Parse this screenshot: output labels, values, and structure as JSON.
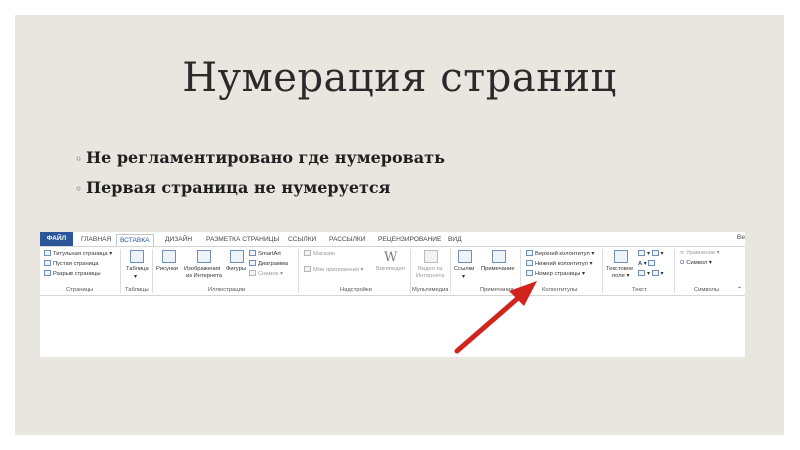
{
  "slide": {
    "title": "Нумерация страниц",
    "bullets": [
      {
        "marker": "◦",
        "text": "Не регламентировано где нумеровать"
      },
      {
        "marker": "◦",
        "text": "Первая страница не нумеруется"
      }
    ]
  },
  "word": {
    "tabs": [
      "ФАЙЛ",
      "ГЛАВНАЯ",
      "ВСТАВКА",
      "ДИЗАЙН",
      "РАЗМЕТКА СТРАНИЦЫ",
      "ССЫЛКИ",
      "РАССЫЛКИ",
      "РЕЦЕНЗИРОВАНИЕ",
      "ВИД"
    ],
    "tab_right": "Ве",
    "active_tab": "ВСТАВКА",
    "pages": {
      "title_page": "Титульная страница",
      "blank_page": "Пустая страница",
      "page_break": "Разрыв страницы",
      "group": "Страницы"
    },
    "tables": {
      "table": "Таблица",
      "group": "Таблицы"
    },
    "illustrations": {
      "pictures": "Рисунки",
      "online_pictures_1": "Изображения",
      "online_pictures_2": "из Интернета",
      "shapes": "Фигуры",
      "smartart": "SmartArt",
      "chart": "Диаграмма",
      "screenshot": "Снимок",
      "group": "Иллюстрации"
    },
    "addins": {
      "store": "Магазин",
      "my_apps": "Мои приложения",
      "wikipedia": "Википедия",
      "group": "Надстройки"
    },
    "media": {
      "video_1": "Видео из",
      "video_2": "Интернета",
      "group": "Мультимедиа"
    },
    "links": {
      "links": "Ссылки"
    },
    "comments": {
      "comment": "Примечание",
      "group": "Примечания"
    },
    "header_footer": {
      "header": "Верхний колонтитул",
      "footer": "Нижний колонтитул",
      "page_number": "Номер страницы",
      "group": "Колонтитулы"
    },
    "text": {
      "textbox_1": "Текстовое",
      "textbox_2": "поле",
      "group": "Текст"
    },
    "symbols": {
      "equation": "Уравнение",
      "symbol": "Символ",
      "group": "Символы"
    }
  },
  "colors": {
    "accent": "#2b579a",
    "arrow": "#d0241c",
    "slide_bg": "#e9e6df"
  }
}
